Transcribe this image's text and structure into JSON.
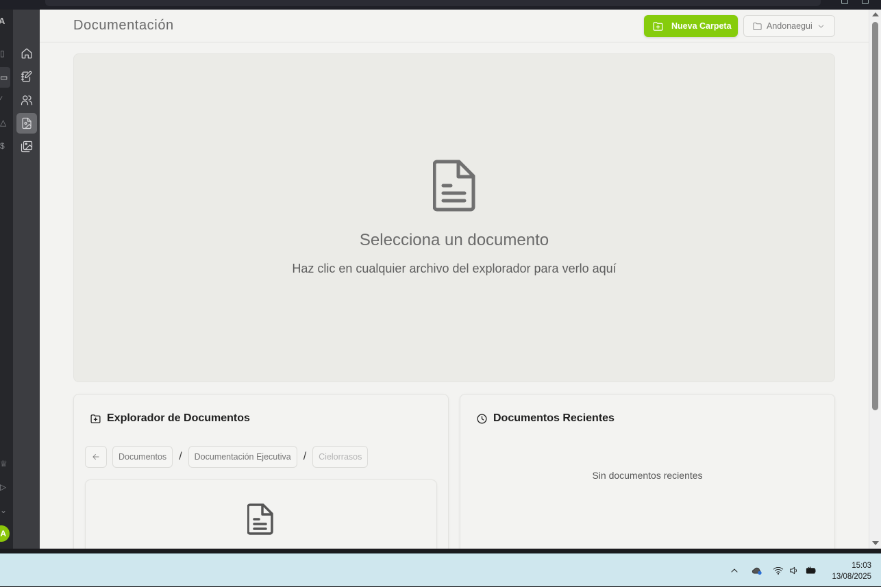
{
  "header": {
    "title": "Documentación",
    "new_folder_label": "Nueva Carpeta",
    "project_name": "Andonaegui"
  },
  "viewer": {
    "title": "Selecciona un documento",
    "subtitle": "Haz clic en cualquier archivo del explorador para verlo aquí"
  },
  "explorer": {
    "title": "Explorador de Documentos",
    "breadcrumb": [
      "Documentos",
      "Documentación Ejecutiva",
      "Cielorrasos"
    ],
    "separator": "/"
  },
  "recent": {
    "title": "Documentos Recientes",
    "empty_text": "Sin documentos recientes"
  },
  "outer_rail": {
    "avatar_initial": "A",
    "app_initial": "A"
  },
  "taskbar": {
    "time": "15:03",
    "date": "13/08/2025"
  },
  "colors": {
    "accent": "#86cc0c",
    "nav_bg": "#3c3d41",
    "page_bg": "#f3f3f1"
  },
  "icons": {
    "nav": [
      "home-icon",
      "notebook-edit-icon",
      "users-icon",
      "file-image-icon",
      "image-gallery-icon"
    ],
    "tray": [
      "chevron-up-icon",
      "onedrive-icon",
      "wifi-icon",
      "speaker-icon",
      "battery-icon"
    ]
  }
}
